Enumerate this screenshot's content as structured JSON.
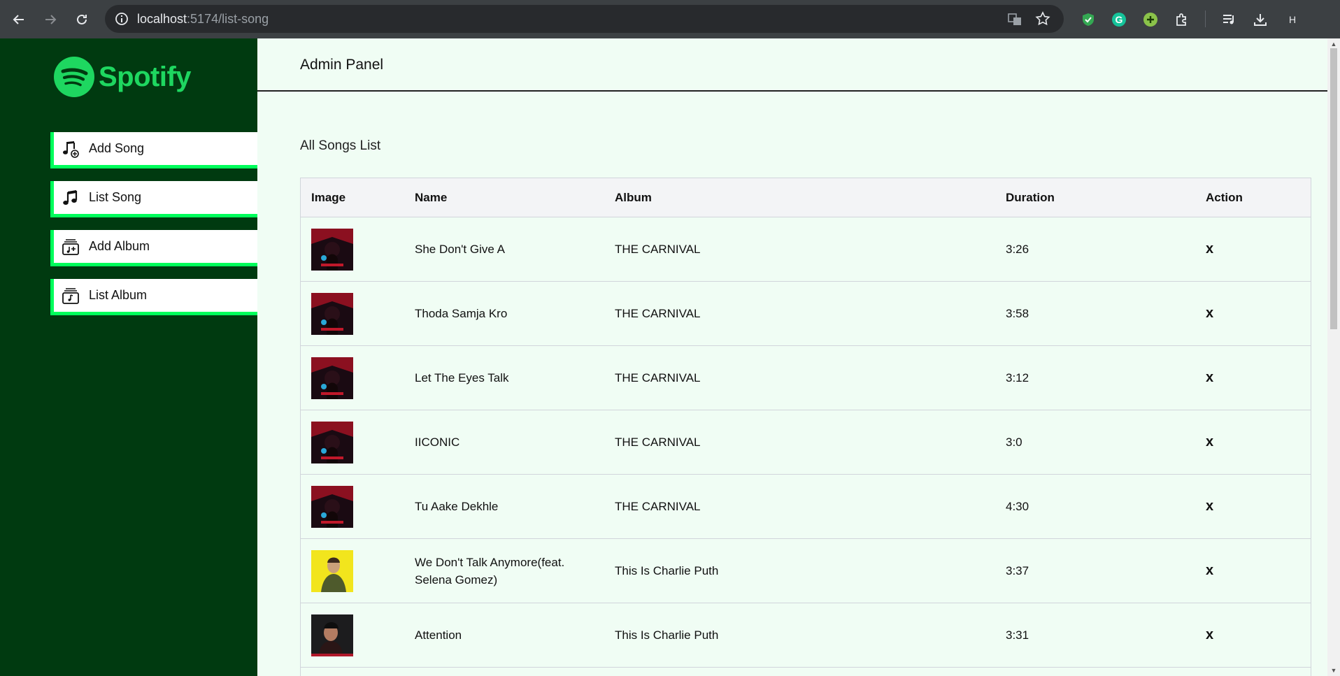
{
  "browser": {
    "url_host": "localhost",
    "url_path": ":5174/list-song",
    "profile_initial": "H"
  },
  "sidebar": {
    "brand": "Spotify",
    "brand_color": "#1ed760",
    "items": [
      {
        "label": "Add Song",
        "icon": "music-note-add-icon"
      },
      {
        "label": "List Song",
        "icon": "music-note-icon"
      },
      {
        "label": "Add Album",
        "icon": "album-add-icon"
      },
      {
        "label": "List Album",
        "icon": "album-list-icon"
      }
    ]
  },
  "header": {
    "title": "Admin Panel"
  },
  "main": {
    "section_title": "All Songs List",
    "columns": [
      "Image",
      "Name",
      "Album",
      "Duration",
      "Action"
    ],
    "rows": [
      {
        "image": "carnival-cover",
        "name": "She Don't Give A",
        "album": "THE CARNIVAL",
        "duration": "3:26",
        "action": "x"
      },
      {
        "image": "carnival-cover",
        "name": "Thoda Samja Kro",
        "album": "THE CARNIVAL",
        "duration": "3:58",
        "action": "x"
      },
      {
        "image": "carnival-cover",
        "name": "Let The Eyes Talk",
        "album": "THE CARNIVAL",
        "duration": "3:12",
        "action": "x"
      },
      {
        "image": "carnival-cover",
        "name": "IICONIC",
        "album": "THE CARNIVAL",
        "duration": "3:0",
        "action": "x"
      },
      {
        "image": "carnival-cover",
        "name": "Tu Aake Dekhle",
        "album": "THE CARNIVAL",
        "duration": "4:30",
        "action": "x"
      },
      {
        "image": "charlie-yellow-cover",
        "name": "We Don't Talk Anymore(feat. Selena Gomez)",
        "album": "This Is Charlie Puth",
        "duration": "3:37",
        "action": "x"
      },
      {
        "image": "charlie-dark-cover",
        "name": "Attention",
        "album": "This Is Charlie Puth",
        "duration": "3:31",
        "action": "x"
      }
    ]
  },
  "colors": {
    "sidebar_bg": "#003a10",
    "accent": "#00ff5b",
    "main_bg": "#f0fdf4"
  }
}
